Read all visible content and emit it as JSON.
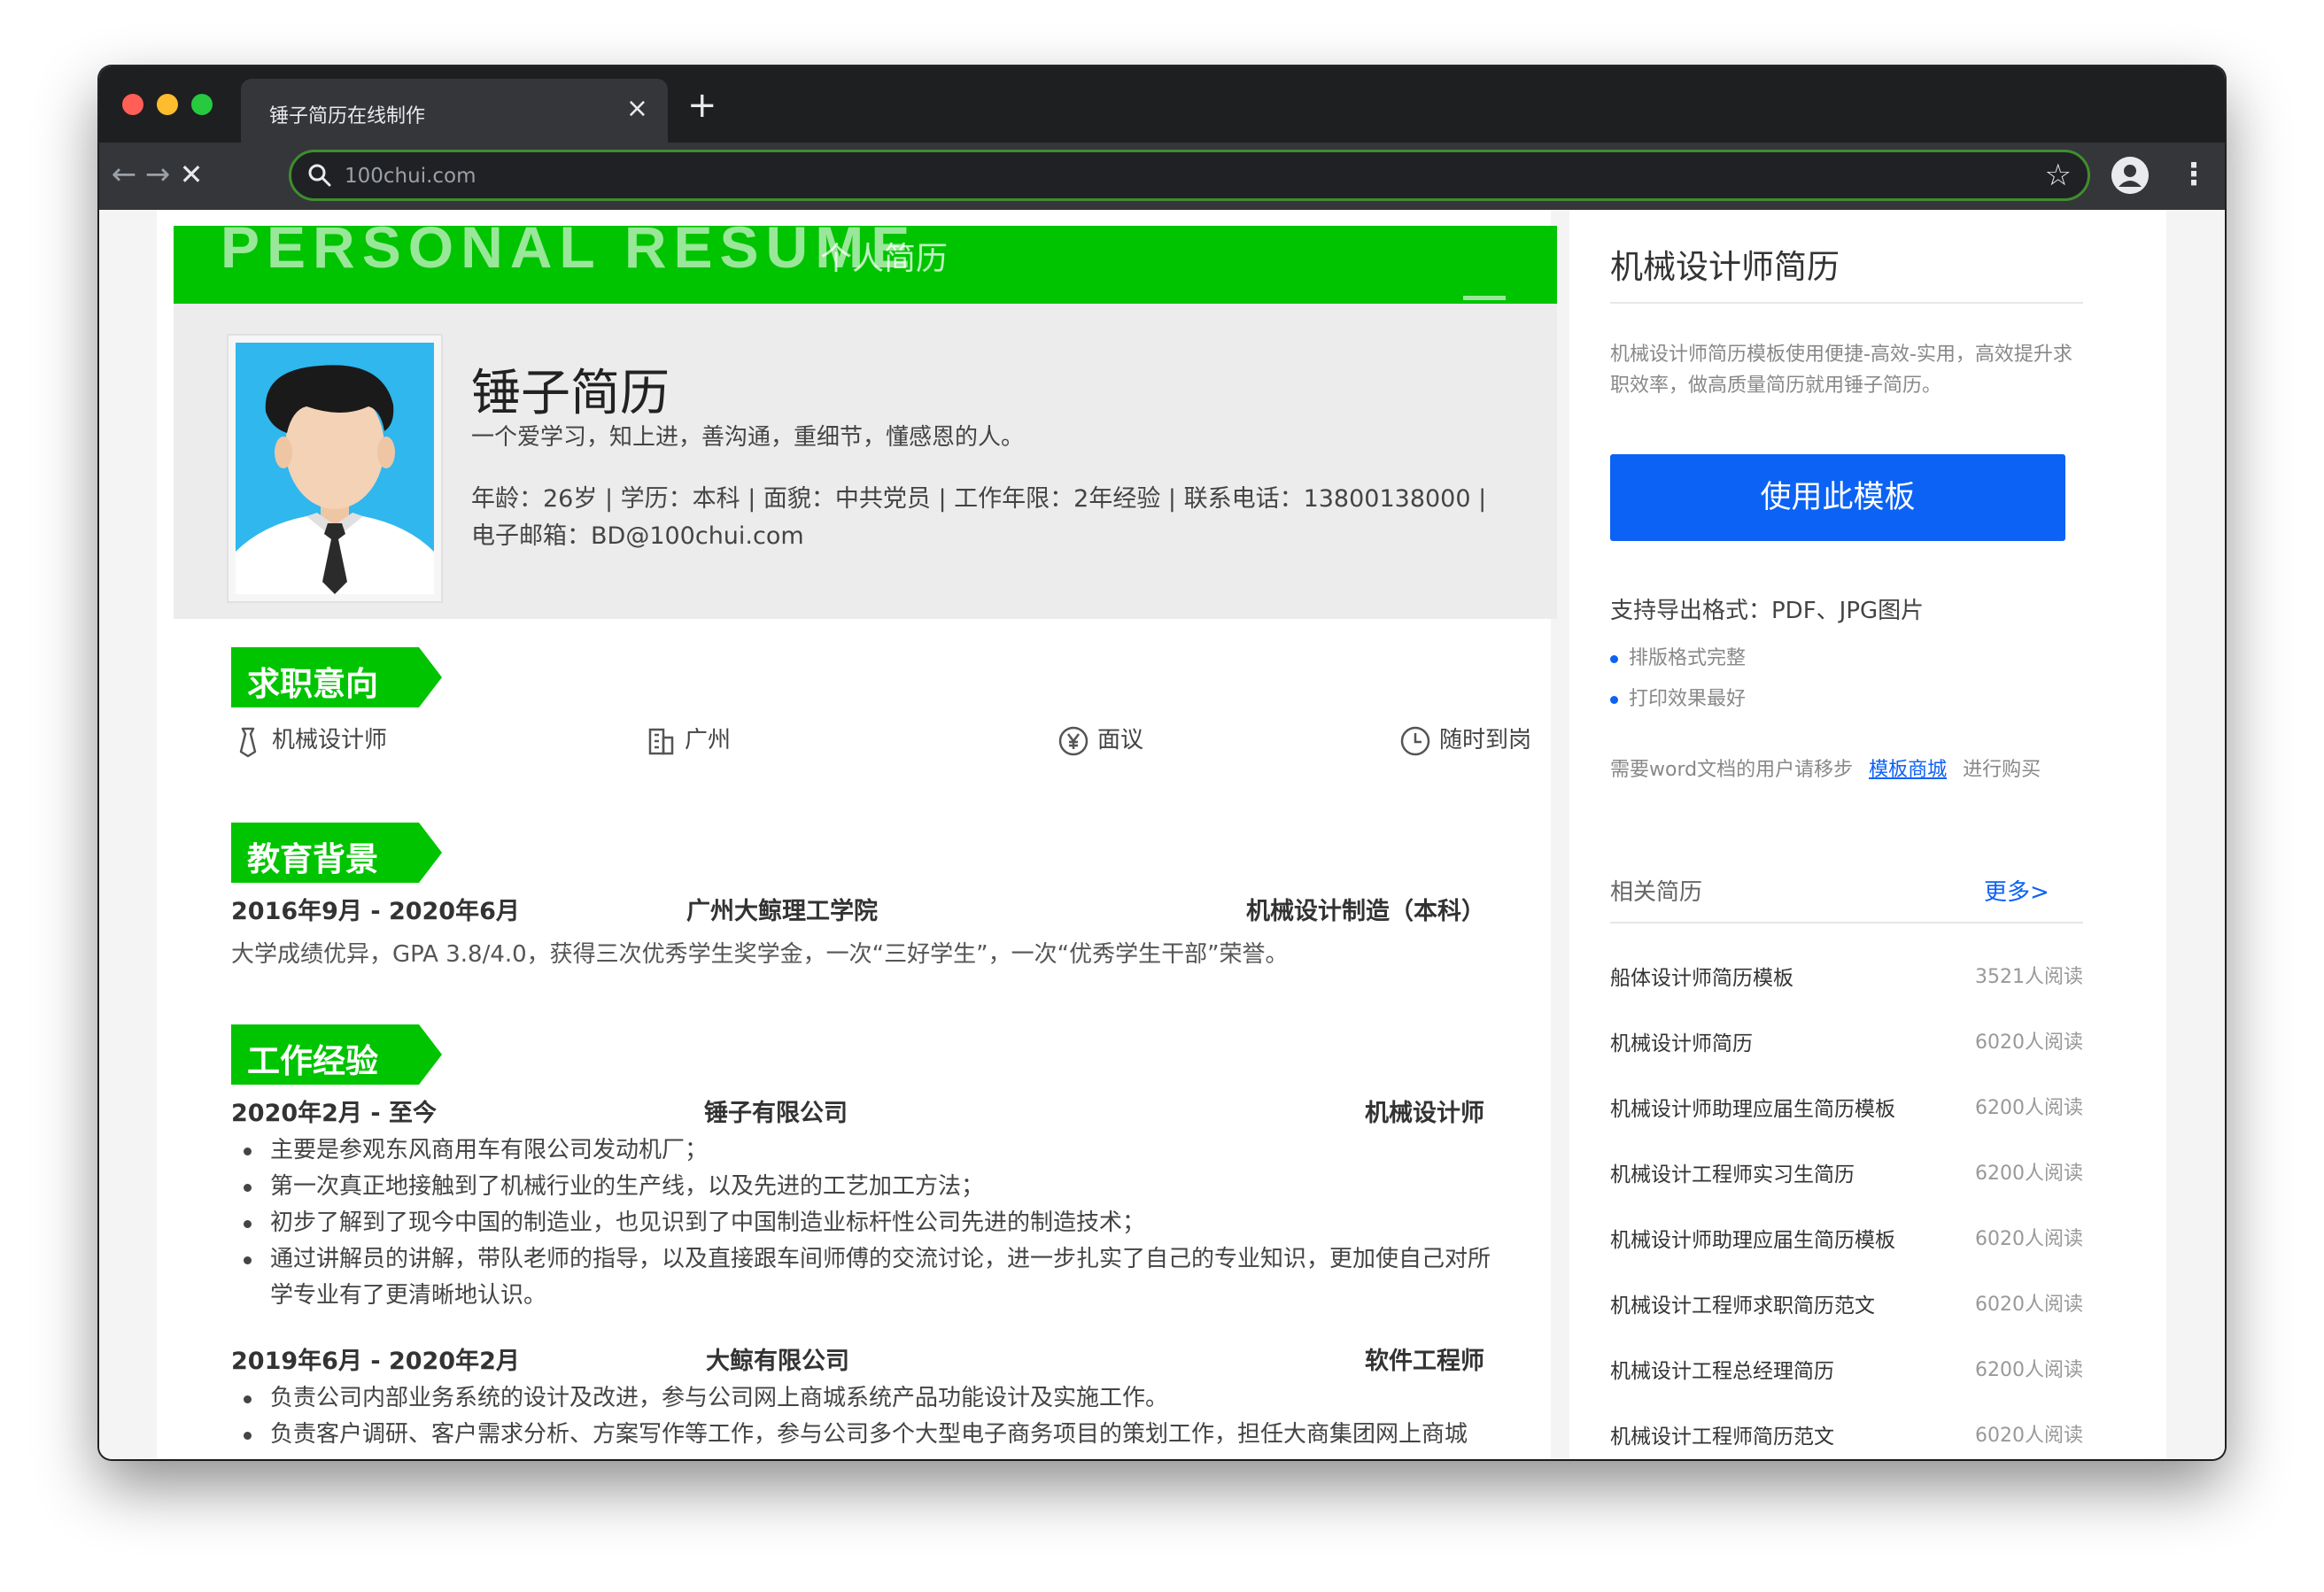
{
  "browser": {
    "tab_title": "锤子简历在线制作",
    "tab_close": "×",
    "new_tab": "+",
    "url": "100chui.com",
    "back": "←",
    "forward": "→",
    "stop": "✕",
    "star": "☆",
    "menu": "⋮"
  },
  "banner": {
    "title_en": "PERSONAL RESUME",
    "title_cn": "个人简历"
  },
  "profile": {
    "name": "锤子简历",
    "motto": "一个爱学习，知上进，善沟通，重细节，懂感恩的人。",
    "info_line1": "年龄：26岁 | 学历：本科 | 面貌：中共党员 | 工作年限：2年经验 | 联系电话：13800138000 |",
    "info_line2": "电子邮箱：BD@100chui.com"
  },
  "sections": {
    "intent": "求职意向",
    "education": "教育背景",
    "work": "工作经验"
  },
  "intent": {
    "position": "机械设计师",
    "city": "广州",
    "salary": "面议",
    "availability": "随时到岗"
  },
  "education": {
    "period": "2016年9月 - 2020年6月",
    "school": "广州大鲸理工学院",
    "major": "机械设计制造（本科）",
    "description": "大学成绩优异，GPA 3.8/4.0，获得三次优秀学生奖学金，一次“三好学生”，一次“优秀学生干部”荣誉。"
  },
  "work": [
    {
      "period": "2020年2月 - 至今",
      "company": "锤子有限公司",
      "title": "机械设计师",
      "bullets": [
        "主要是参观东风商用车有限公司发动机厂；",
        "第一次真正地接触到了机械行业的生产线，以及先进的工艺加工方法；",
        "初步了解到了现今中国的制造业，也见识到了中国制造业标杆性公司先进的制造技术；",
        "通过讲解员的讲解，带队老师的指导，以及直接跟车间师傅的交流讨论，进一步扎实了自己的专业知识，更加使自己对所学专业有了更清晰地认识。"
      ]
    },
    {
      "period": "2019年6月 - 2020年2月",
      "company": "大鲸有限公司",
      "title": "软件工程师",
      "bullets": [
        "负责公司内部业务系统的设计及改进，参与公司网上商城系统产品功能设计及实施工作。",
        "负责客户调研、客户需求分析、方案写作等工作，参与公司多个大型电子商务项目的策划工作，担任大商集团网上商城"
      ]
    }
  ],
  "sidebar": {
    "title": "机械设计师简历",
    "description": "机械设计师简历模板使用便捷-高效-实用，高效提升求职效率，做高质量简历就用锤子简历。",
    "use_button": "使用此模板",
    "formats": "支持导出格式：PDF、JPG图片",
    "features": [
      "排版格式完整",
      "打印效果最好"
    ],
    "word_note_prefix": "需要word文档的用户请移步",
    "word_note_link": "模板商城",
    "word_note_suffix": "进行购买",
    "related_title": "相关简历",
    "more": "更多>",
    "related": [
      {
        "name": "船体设计师简历模板",
        "count": "3521人阅读"
      },
      {
        "name": "机械设计师简历",
        "count": "6020人阅读"
      },
      {
        "name": "机械设计师助理应届生简历模板",
        "count": "6200人阅读"
      },
      {
        "name": "机械设计工程师实习生简历",
        "count": "6200人阅读"
      },
      {
        "name": "机械设计师助理应届生简历模板",
        "count": "6020人阅读"
      },
      {
        "name": "机械设计工程师求职简历范文",
        "count": "6020人阅读"
      },
      {
        "name": "机械设计工程总经理简历",
        "count": "6200人阅读"
      },
      {
        "name": "机械设计工程师简历范文",
        "count": "6020人阅读"
      }
    ]
  },
  "colors": {
    "accent_green": "#00c400",
    "primary_blue": "#0b62f5"
  }
}
